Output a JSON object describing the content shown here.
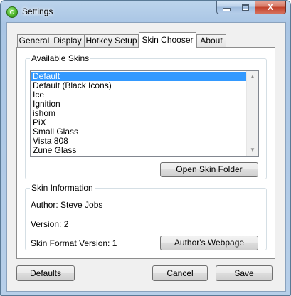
{
  "window": {
    "title": "Settings",
    "icon": "settings-gear-icon",
    "close_glyph": "X"
  },
  "tabs": [
    {
      "label": "General",
      "active": false
    },
    {
      "label": "Display",
      "active": false
    },
    {
      "label": "Hotkey Setup",
      "active": false
    },
    {
      "label": "Skin Chooser",
      "active": true
    },
    {
      "label": "About",
      "active": false
    }
  ],
  "available_skins": {
    "legend": "Available Skins",
    "items": [
      "Default",
      "Default (Black Icons)",
      "Ice",
      "Ignition",
      "ishom",
      "PiX",
      "Small Glass",
      "Vista 808",
      "Zune Glass"
    ],
    "selected": "Default",
    "open_folder_label": "Open Skin Folder"
  },
  "skin_information": {
    "legend": "Skin Information",
    "author_line": "Author: Steve Jobs",
    "version_line": "Version: 2",
    "format_line": "Skin Format Version: 1",
    "webpage_label": "Author's Webpage"
  },
  "footer": {
    "defaults_label": "Defaults",
    "cancel_label": "Cancel",
    "save_label": "Save"
  },
  "colors": {
    "selection": "#3399ff",
    "title_bar": "#b7cfe9",
    "close_button": "#c2412a"
  }
}
